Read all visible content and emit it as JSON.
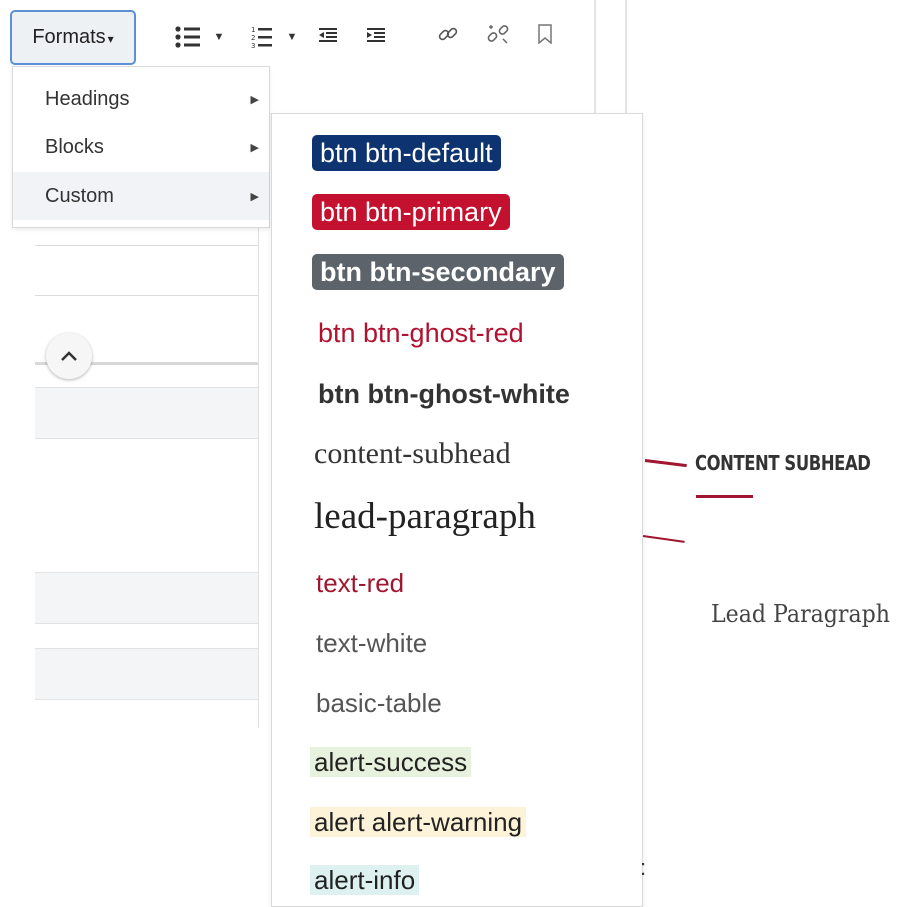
{
  "toolbar": {
    "formats_label": "Formats",
    "icons": [
      "bullet-list-icon",
      "numbered-list-icon",
      "outdent-icon",
      "indent-icon",
      "link-icon",
      "unlink-icon",
      "bookmark-icon"
    ]
  },
  "formats_menu": {
    "items": [
      {
        "label": "Headings"
      },
      {
        "label": "Blocks"
      },
      {
        "label": "Custom"
      }
    ],
    "active": "Custom"
  },
  "custom_submenu": {
    "items": [
      {
        "label": "btn btn-default"
      },
      {
        "label": "btn btn-primary"
      },
      {
        "label": "btn btn-secondary"
      },
      {
        "label": "btn btn-ghost-red"
      },
      {
        "label": "btn btn-ghost-white"
      },
      {
        "label": "content-subhead"
      },
      {
        "label": "lead-paragraph"
      },
      {
        "label": "text-red"
      },
      {
        "label": "text-white"
      },
      {
        "label": "basic-table"
      },
      {
        "label": "alert-success"
      },
      {
        "label": "alert alert-warning"
      },
      {
        "label": "alert-info"
      }
    ]
  },
  "annotations": {
    "content_subhead": "CONTENT SUBHEAD",
    "lead_paragraph": "Lead Paragraph"
  },
  "colors": {
    "btn_default": "#0d3370",
    "btn_primary": "#c4112f",
    "btn_secondary": "#5c636b",
    "accent_red": "#a01530",
    "alert_success": "#e6f2dd",
    "alert_warning": "#fdf3d8",
    "alert_info": "#def1f1"
  }
}
